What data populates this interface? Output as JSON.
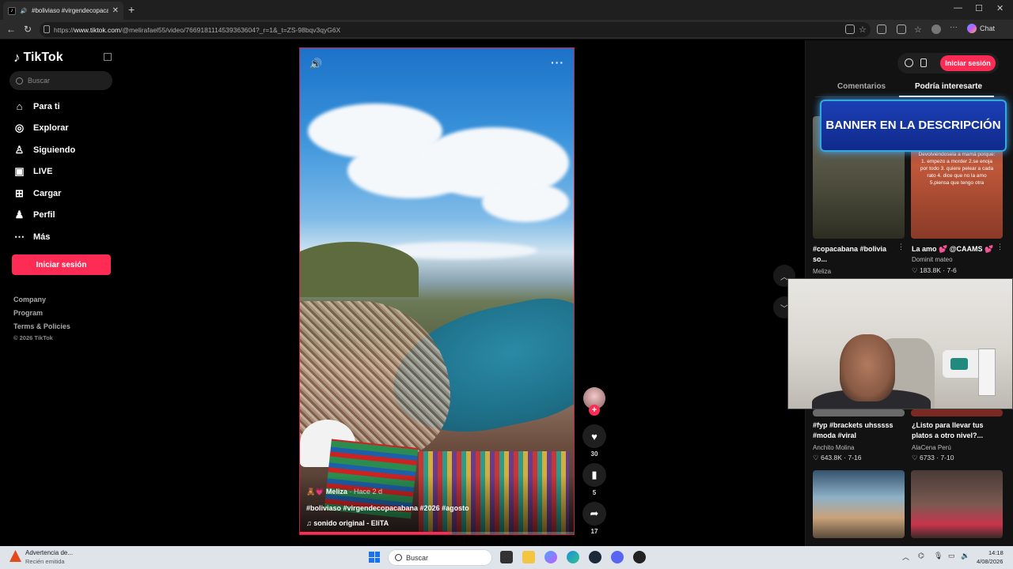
{
  "browser": {
    "tab_title": "#boliviaso #virgendecopacabana",
    "tab_close": "✕",
    "new_tab": "+",
    "url_prefix": "https://",
    "url_host": "www.tiktok.com",
    "url_path": "/@melirafael55/video/7669181114539363604?_r=1&_t=ZS-98bqv3qyG6X",
    "chat_label": "Chat",
    "win_min": "—",
    "win_max": "☐",
    "win_close": "✕"
  },
  "sidebar": {
    "brand": "TikTok",
    "search_placeholder": "Buscar",
    "nav": [
      {
        "label": "Para ti",
        "icon": "home-icon",
        "glyph": "⌂"
      },
      {
        "label": "Explorar",
        "icon": "compass-icon",
        "glyph": "◎"
      },
      {
        "label": "Siguiendo",
        "icon": "following-icon",
        "glyph": "♙"
      },
      {
        "label": "LIVE",
        "icon": "live-icon",
        "glyph": "▣"
      },
      {
        "label": "Cargar",
        "icon": "upload-icon",
        "glyph": "⊞"
      },
      {
        "label": "Perfil",
        "icon": "profile-icon",
        "glyph": "♟"
      },
      {
        "label": "Más",
        "icon": "more-icon",
        "glyph": "⋯"
      }
    ],
    "login_label": "Iniciar sesión",
    "footer_links": [
      "Company",
      "Program",
      "Terms & Policies"
    ],
    "copyright": "© 2026 TikTok"
  },
  "video": {
    "author": "Meliza",
    "time_ago": "· Hace 2 d",
    "caption": "#boliviaso #virgendecopacabana #2026 #agosto",
    "sound": "sonido original - EliTA",
    "progress": 0.55
  },
  "actions": {
    "likes": "30",
    "saves": "5",
    "shares": "17"
  },
  "right_panel": {
    "login_label": "Iniciar sesión",
    "tabs": [
      "Comentarios",
      "Podría interesarte"
    ],
    "active_tab": 1,
    "banner_text": "BANNER EN LA DESCRIPCIÓN",
    "cards": [
      {
        "title": "#copacabana #bolivia so...",
        "author": "Meliza",
        "stat": ""
      },
      {
        "title": "La amo 💕 @CAAMS 💕",
        "author": "Dominit mateo",
        "stat": "♡ 183.8K · 7-6",
        "overlay": "Devolviéndosela a mamá porque: 1. empezo a morder 2.se enoja por todo 3. quiere pelear a cada rato 4. dice que no la amo 5.piensa que tengo otra"
      },
      {
        "title": "#fyp #brackets uhsssss #moda #viral",
        "author": "Anchito Molina",
        "stat": "♡ 643.8K · 7-16"
      },
      {
        "title": "¿Listo para llevar tus platos a otro nivel?...",
        "author": "AlaCena Perú",
        "stat": "♡ 6733 · 7-10"
      }
    ]
  },
  "taskbar": {
    "warning_title": "Advertencia de...",
    "warning_sub": "Recién emitida",
    "search_placeholder": "Buscar",
    "time": "14:18",
    "date": "4/08/2026"
  }
}
